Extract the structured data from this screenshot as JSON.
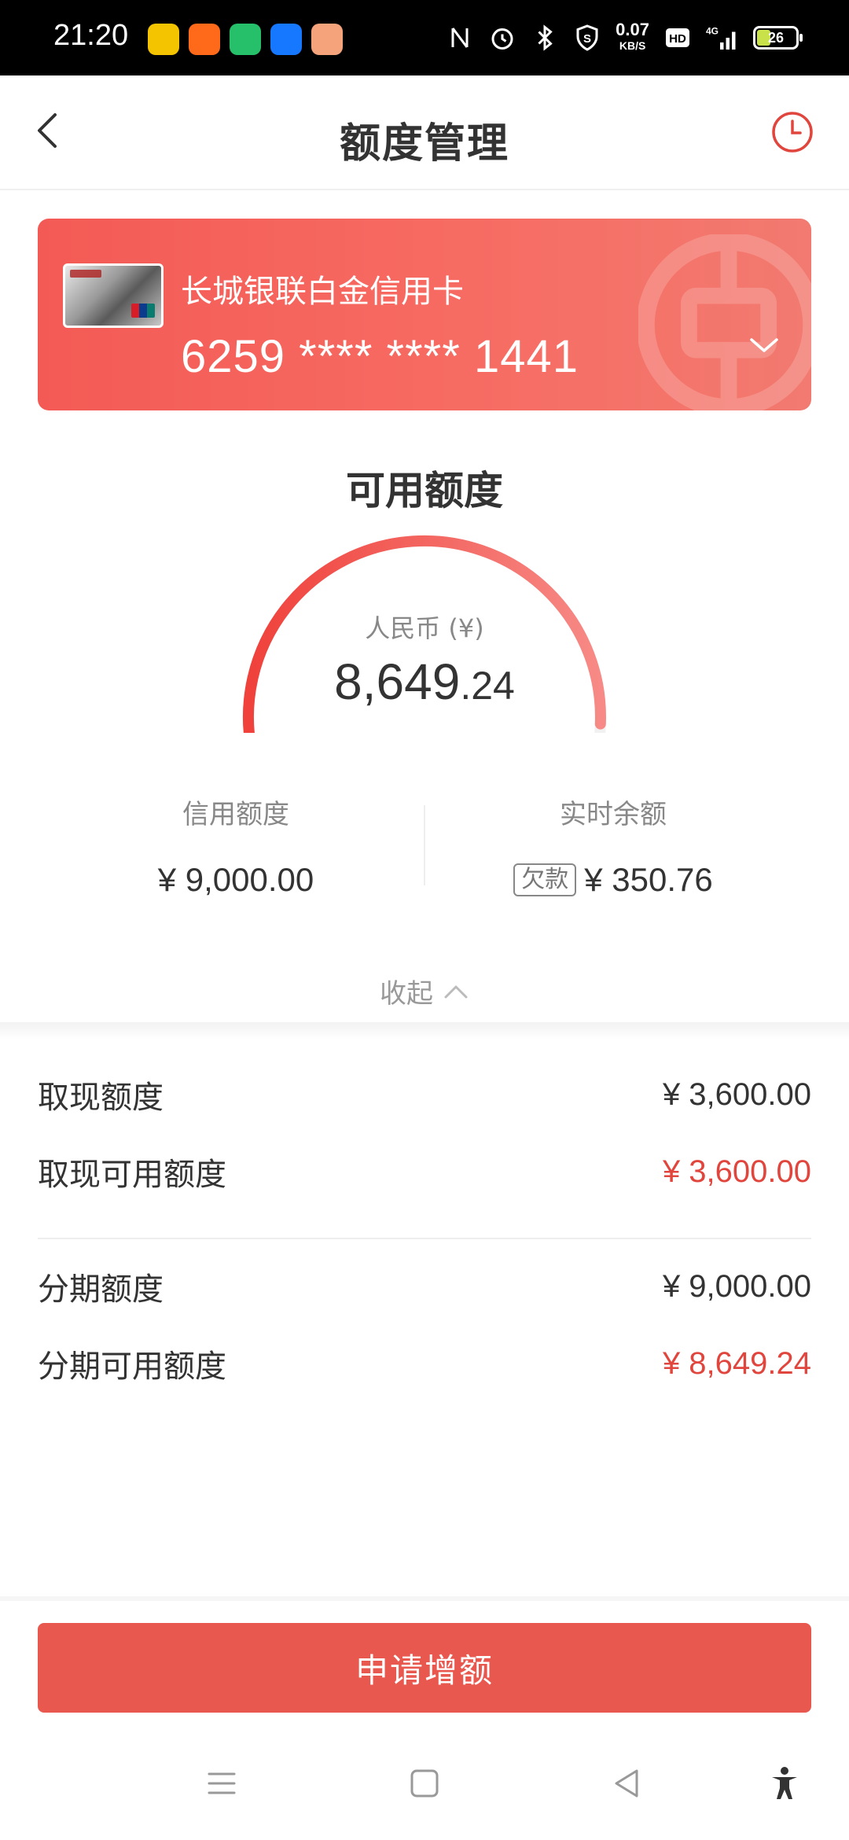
{
  "status_bar": {
    "time": "21:20",
    "speed_value": "0.07",
    "speed_unit": "KB/S",
    "hd": "HD",
    "network": "4G",
    "battery": "26",
    "app_icons": [
      "app-icon-yellow",
      "app-icon-orange",
      "app-icon-green",
      "app-icon-blue",
      "app-icon-peach"
    ]
  },
  "header": {
    "title": "额度管理",
    "back_icon": "back-arrow-icon",
    "history_icon": "clock-icon"
  },
  "card": {
    "name": "长城银联白金信用卡",
    "number": "6259 **** **** 1441"
  },
  "available": {
    "title": "可用额度",
    "currency": "人民币 (¥)",
    "amount_int": "8,649",
    "amount_dec": ".24",
    "ratio": 0.961
  },
  "stats": {
    "credit_label": "信用额度",
    "credit_value": "¥ 9,000.00",
    "balance_label": "实时余额",
    "balance_badge": "欠款",
    "balance_value": "¥ 350.76"
  },
  "collapse_label": "收起",
  "details": {
    "rows": [
      {
        "label": "取现额度",
        "value": "¥ 3,600.00"
      },
      {
        "label": "取现可用额度",
        "value": "¥ 3,600.00"
      },
      {
        "label": "分期额度",
        "value": "¥ 9,000.00"
      },
      {
        "label": "分期可用额度",
        "value": "¥ 8,649.24"
      }
    ]
  },
  "apply_button": "申请增额",
  "colors": {
    "accent": "#e9584f",
    "highlight_red": "#e0463d",
    "banner_start": "#f45a55",
    "banner_end": "#f27a70"
  },
  "nav": [
    "menu-icon",
    "home-square-icon",
    "back-triangle-icon",
    "accessibility-icon"
  ]
}
